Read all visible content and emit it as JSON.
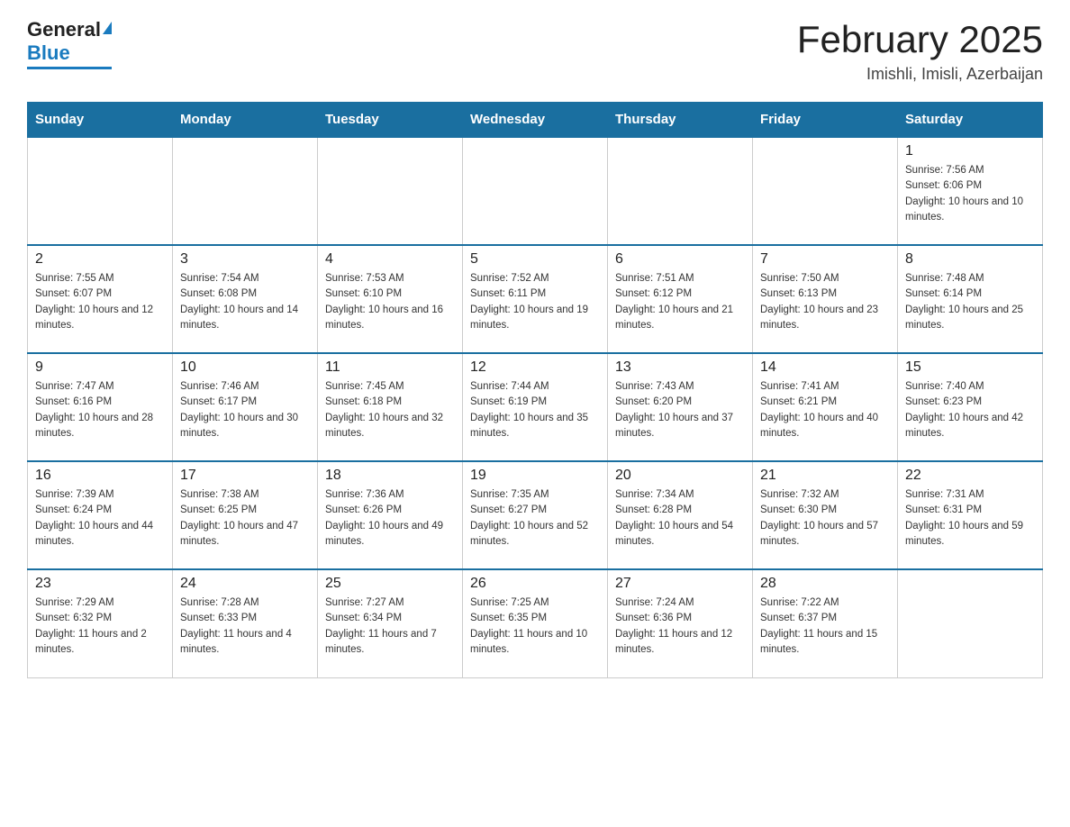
{
  "header": {
    "logo_general": "General",
    "logo_blue": "Blue",
    "title": "February 2025",
    "subtitle": "Imishli, Imisli, Azerbaijan"
  },
  "days_of_week": [
    "Sunday",
    "Monday",
    "Tuesday",
    "Wednesday",
    "Thursday",
    "Friday",
    "Saturday"
  ],
  "weeks": [
    {
      "days": [
        {
          "number": "",
          "sunrise": "",
          "sunset": "",
          "daylight": "",
          "empty": true
        },
        {
          "number": "",
          "sunrise": "",
          "sunset": "",
          "daylight": "",
          "empty": true
        },
        {
          "number": "",
          "sunrise": "",
          "sunset": "",
          "daylight": "",
          "empty": true
        },
        {
          "number": "",
          "sunrise": "",
          "sunset": "",
          "daylight": "",
          "empty": true
        },
        {
          "number": "",
          "sunrise": "",
          "sunset": "",
          "daylight": "",
          "empty": true
        },
        {
          "number": "",
          "sunrise": "",
          "sunset": "",
          "daylight": "",
          "empty": true
        },
        {
          "number": "1",
          "sunrise": "Sunrise: 7:56 AM",
          "sunset": "Sunset: 6:06 PM",
          "daylight": "Daylight: 10 hours and 10 minutes.",
          "empty": false
        }
      ]
    },
    {
      "days": [
        {
          "number": "2",
          "sunrise": "Sunrise: 7:55 AM",
          "sunset": "Sunset: 6:07 PM",
          "daylight": "Daylight: 10 hours and 12 minutes.",
          "empty": false
        },
        {
          "number": "3",
          "sunrise": "Sunrise: 7:54 AM",
          "sunset": "Sunset: 6:08 PM",
          "daylight": "Daylight: 10 hours and 14 minutes.",
          "empty": false
        },
        {
          "number": "4",
          "sunrise": "Sunrise: 7:53 AM",
          "sunset": "Sunset: 6:10 PM",
          "daylight": "Daylight: 10 hours and 16 minutes.",
          "empty": false
        },
        {
          "number": "5",
          "sunrise": "Sunrise: 7:52 AM",
          "sunset": "Sunset: 6:11 PM",
          "daylight": "Daylight: 10 hours and 19 minutes.",
          "empty": false
        },
        {
          "number": "6",
          "sunrise": "Sunrise: 7:51 AM",
          "sunset": "Sunset: 6:12 PM",
          "daylight": "Daylight: 10 hours and 21 minutes.",
          "empty": false
        },
        {
          "number": "7",
          "sunrise": "Sunrise: 7:50 AM",
          "sunset": "Sunset: 6:13 PM",
          "daylight": "Daylight: 10 hours and 23 minutes.",
          "empty": false
        },
        {
          "number": "8",
          "sunrise": "Sunrise: 7:48 AM",
          "sunset": "Sunset: 6:14 PM",
          "daylight": "Daylight: 10 hours and 25 minutes.",
          "empty": false
        }
      ]
    },
    {
      "days": [
        {
          "number": "9",
          "sunrise": "Sunrise: 7:47 AM",
          "sunset": "Sunset: 6:16 PM",
          "daylight": "Daylight: 10 hours and 28 minutes.",
          "empty": false
        },
        {
          "number": "10",
          "sunrise": "Sunrise: 7:46 AM",
          "sunset": "Sunset: 6:17 PM",
          "daylight": "Daylight: 10 hours and 30 minutes.",
          "empty": false
        },
        {
          "number": "11",
          "sunrise": "Sunrise: 7:45 AM",
          "sunset": "Sunset: 6:18 PM",
          "daylight": "Daylight: 10 hours and 32 minutes.",
          "empty": false
        },
        {
          "number": "12",
          "sunrise": "Sunrise: 7:44 AM",
          "sunset": "Sunset: 6:19 PM",
          "daylight": "Daylight: 10 hours and 35 minutes.",
          "empty": false
        },
        {
          "number": "13",
          "sunrise": "Sunrise: 7:43 AM",
          "sunset": "Sunset: 6:20 PM",
          "daylight": "Daylight: 10 hours and 37 minutes.",
          "empty": false
        },
        {
          "number": "14",
          "sunrise": "Sunrise: 7:41 AM",
          "sunset": "Sunset: 6:21 PM",
          "daylight": "Daylight: 10 hours and 40 minutes.",
          "empty": false
        },
        {
          "number": "15",
          "sunrise": "Sunrise: 7:40 AM",
          "sunset": "Sunset: 6:23 PM",
          "daylight": "Daylight: 10 hours and 42 minutes.",
          "empty": false
        }
      ]
    },
    {
      "days": [
        {
          "number": "16",
          "sunrise": "Sunrise: 7:39 AM",
          "sunset": "Sunset: 6:24 PM",
          "daylight": "Daylight: 10 hours and 44 minutes.",
          "empty": false
        },
        {
          "number": "17",
          "sunrise": "Sunrise: 7:38 AM",
          "sunset": "Sunset: 6:25 PM",
          "daylight": "Daylight: 10 hours and 47 minutes.",
          "empty": false
        },
        {
          "number": "18",
          "sunrise": "Sunrise: 7:36 AM",
          "sunset": "Sunset: 6:26 PM",
          "daylight": "Daylight: 10 hours and 49 minutes.",
          "empty": false
        },
        {
          "number": "19",
          "sunrise": "Sunrise: 7:35 AM",
          "sunset": "Sunset: 6:27 PM",
          "daylight": "Daylight: 10 hours and 52 minutes.",
          "empty": false
        },
        {
          "number": "20",
          "sunrise": "Sunrise: 7:34 AM",
          "sunset": "Sunset: 6:28 PM",
          "daylight": "Daylight: 10 hours and 54 minutes.",
          "empty": false
        },
        {
          "number": "21",
          "sunrise": "Sunrise: 7:32 AM",
          "sunset": "Sunset: 6:30 PM",
          "daylight": "Daylight: 10 hours and 57 minutes.",
          "empty": false
        },
        {
          "number": "22",
          "sunrise": "Sunrise: 7:31 AM",
          "sunset": "Sunset: 6:31 PM",
          "daylight": "Daylight: 10 hours and 59 minutes.",
          "empty": false
        }
      ]
    },
    {
      "days": [
        {
          "number": "23",
          "sunrise": "Sunrise: 7:29 AM",
          "sunset": "Sunset: 6:32 PM",
          "daylight": "Daylight: 11 hours and 2 minutes.",
          "empty": false
        },
        {
          "number": "24",
          "sunrise": "Sunrise: 7:28 AM",
          "sunset": "Sunset: 6:33 PM",
          "daylight": "Daylight: 11 hours and 4 minutes.",
          "empty": false
        },
        {
          "number": "25",
          "sunrise": "Sunrise: 7:27 AM",
          "sunset": "Sunset: 6:34 PM",
          "daylight": "Daylight: 11 hours and 7 minutes.",
          "empty": false
        },
        {
          "number": "26",
          "sunrise": "Sunrise: 7:25 AM",
          "sunset": "Sunset: 6:35 PM",
          "daylight": "Daylight: 11 hours and 10 minutes.",
          "empty": false
        },
        {
          "number": "27",
          "sunrise": "Sunrise: 7:24 AM",
          "sunset": "Sunset: 6:36 PM",
          "daylight": "Daylight: 11 hours and 12 minutes.",
          "empty": false
        },
        {
          "number": "28",
          "sunrise": "Sunrise: 7:22 AM",
          "sunset": "Sunset: 6:37 PM",
          "daylight": "Daylight: 11 hours and 15 minutes.",
          "empty": false
        },
        {
          "number": "",
          "sunrise": "",
          "sunset": "",
          "daylight": "",
          "empty": true
        }
      ]
    }
  ]
}
